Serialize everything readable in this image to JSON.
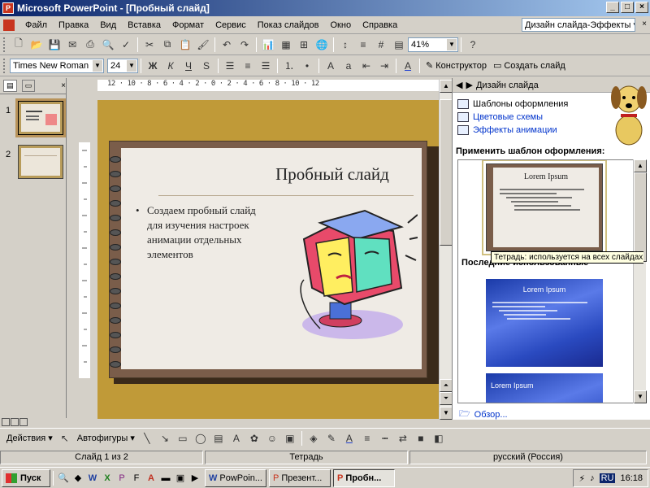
{
  "window": {
    "title": "Microsoft PowerPoint - [Пробный слайд]"
  },
  "menu": {
    "items": [
      "Файл",
      "Правка",
      "Вид",
      "Вставка",
      "Формат",
      "Сервис",
      "Показ слайдов",
      "Окно",
      "Справка"
    ],
    "help_box": "Дизайн слайда-Эффекты"
  },
  "toolbar": {
    "zoom": "41%",
    "font_name": "Times New Roman",
    "font_size": "24",
    "bold": "Ж",
    "italic": "К",
    "underline": "Ч",
    "shadow": "S",
    "designer": "Конструктор",
    "new_slide": "Создать слайд"
  },
  "ruler": {
    "h_text": "12 · 10 · 8 · 6 · 4 · 2 · 0 · 2 · 4 · 6 · 8 · 10 · 12"
  },
  "thumbnails": {
    "items": [
      {
        "number": "1"
      },
      {
        "number": "2"
      }
    ]
  },
  "slide": {
    "title": "Пробный слайд",
    "bullet": "Создаем пробный слайд для изучения настроек анимации отдельных элементов"
  },
  "taskpane": {
    "title": "Дизайн слайда",
    "links": [
      "Шаблоны оформления",
      "Цветовые схемы",
      "Эффекты анимации"
    ],
    "apply_heading": "Применить шаблон оформления:",
    "tooltip": "Тетрадь: используется на всех слайдах",
    "recent_heading": "Последние использованные",
    "template_title": "Lorem Ipsum",
    "browse": "Обзор..."
  },
  "drawbar": {
    "actions": "Действия",
    "autoshapes": "Автофигуры"
  },
  "status": {
    "slide": "Слайд 1 из 2",
    "design": "Тетрадь",
    "lang": "русский (Россия)"
  },
  "taskbar": {
    "start": "Пуск",
    "tasks": [
      "PowPoin...",
      "Презент...",
      "Пробн..."
    ],
    "lang": "RU",
    "clock": "16:18"
  },
  "colors": {
    "title_bar": "#0a246a",
    "slide_bg": "#c09a38",
    "notebook_border": "#7a5d4a",
    "link_blue": "#0033cc"
  }
}
